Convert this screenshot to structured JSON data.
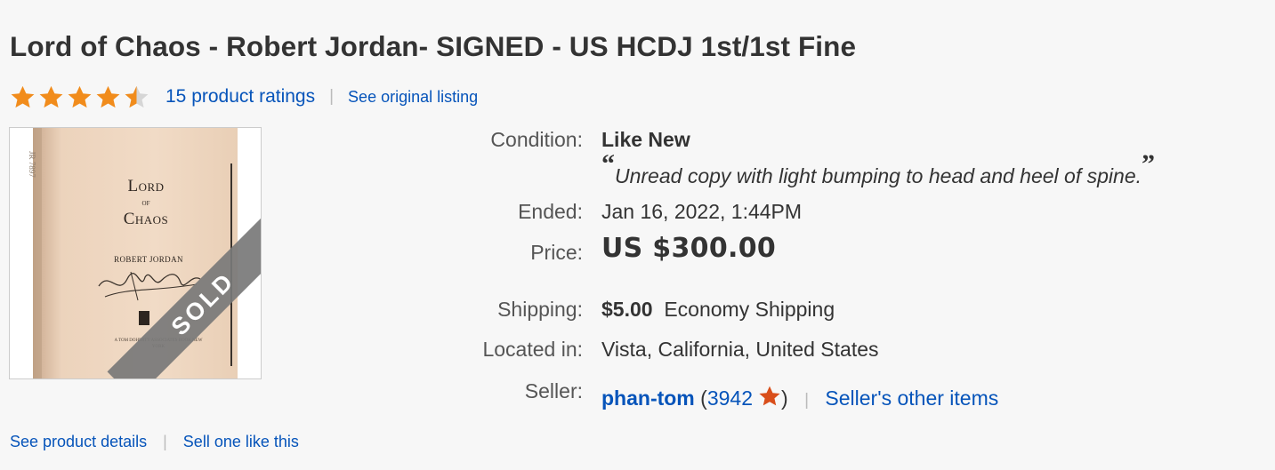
{
  "listing": {
    "title": "Lord of Chaos - Robert Jordan- SIGNED - US HCDJ 1st/1st Fine",
    "rating_stars": 4.5,
    "ratings_link": "15 product ratings",
    "see_original": "See original listing"
  },
  "image": {
    "book_title_1": "Lord",
    "book_title_of": "of",
    "book_title_2": "Chaos",
    "book_author": "ROBERT JORDAN",
    "spine_text": "JR 7897",
    "publisher_text": "A TOM DOHERTY ASSOCIATES BOOK NEW YORK",
    "sold_badge": "SOLD"
  },
  "details": {
    "condition_label": "Condition:",
    "condition_value": "Like New",
    "condition_open_quote": "“",
    "condition_desc": "Unread copy with light bumping to head and heel of spine.",
    "condition_close_quote": "”",
    "ended_label": "Ended:",
    "ended_date": "Jan 16, 2022",
    "ended_sep": ",",
    "ended_time": "1:44PM",
    "price_label": "Price:",
    "price_value": "US $300.00",
    "shipping_label": "Shipping:",
    "shipping_amount": "$5.00",
    "shipping_method": "Economy Shipping",
    "location_label": "Located in:",
    "location_value": "Vista, California, United States",
    "seller_label": "Seller:",
    "seller_name": "phan-tom",
    "feedback_open": "(",
    "feedback_score": "3942",
    "feedback_close": ")",
    "seller_sep": "|",
    "seller_other": "Seller's other items"
  },
  "bottom": {
    "see_details": "See product details",
    "sell_one": "Sell one like this",
    "sep": "|"
  },
  "colors": {
    "link": "#0654ba",
    "star": "#f18c1c",
    "star_empty": "#d6d6d6",
    "feedback_star": "#d94e1a"
  }
}
